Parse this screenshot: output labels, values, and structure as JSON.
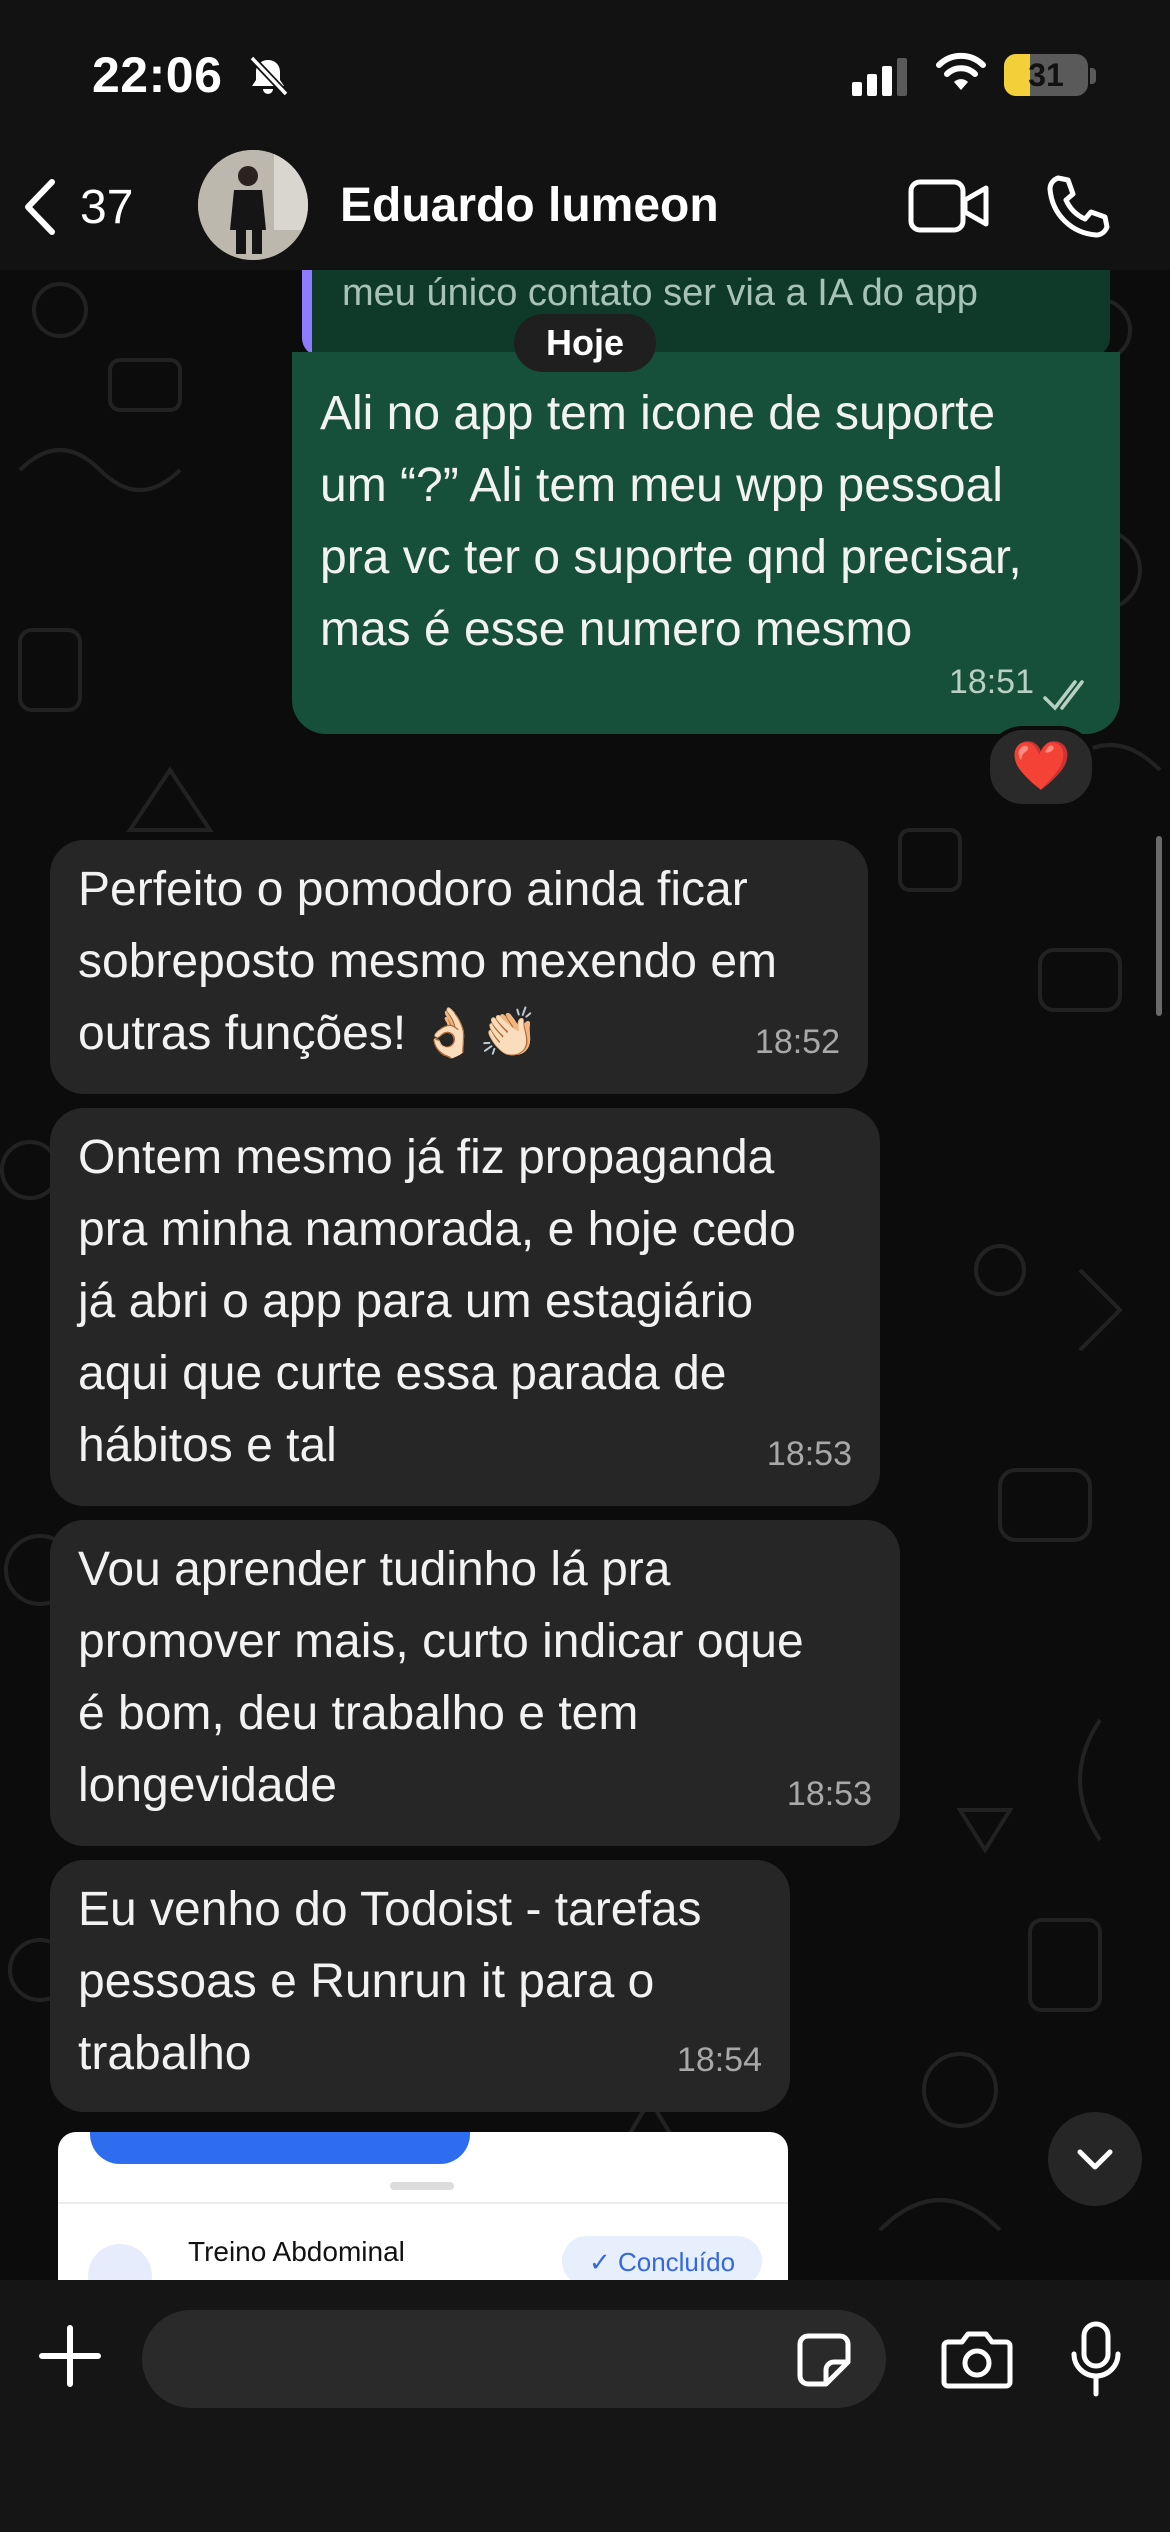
{
  "status_bar": {
    "time": "22:06",
    "battery_level": "31",
    "battery_fraction": 0.31
  },
  "header": {
    "back_count": "37",
    "contact_name": "Eduardo lumeon"
  },
  "quoted": {
    "text": "meu único contato ser via a IA do app"
  },
  "date_chip": "Hoje",
  "messages": [
    {
      "direction": "out",
      "text": "Ali no app tem icone de suporte\num “?” Ali tem meu wpp pessoal\npra vc ter o suporte qnd precisar,\nmas é esse numero mesmo",
      "time": "18:51",
      "status": "read"
    },
    {
      "direction": "in",
      "text": "Perfeito o pomodoro ainda ficar\nsobreposto mesmo mexendo em\noutras funções! 👌🏻👏🏻",
      "time": "18:52"
    },
    {
      "direction": "in",
      "text": "Ontem mesmo já fiz propaganda\npra minha namorada, e hoje cedo\njá abri o app para um estagiário\naqui que curte essa parada de\nhábitos e tal",
      "time": "18:53"
    },
    {
      "direction": "in",
      "text": "Vou aprender tudinho lá pra\npromover mais, curto indicar oque\né bom, deu trabalho e tem\nlongevidade",
      "time": "18:53"
    },
    {
      "direction": "in",
      "text": "Eu venho do Todoist - tarefas\npessoas e Runrun it para o\ntrabalho",
      "time": "18:54"
    }
  ],
  "reaction": "❤️",
  "media_preview": {
    "title": "Treino Abdominal",
    "status_label": "✓ Concluído"
  },
  "composer": {
    "placeholder": ""
  }
}
